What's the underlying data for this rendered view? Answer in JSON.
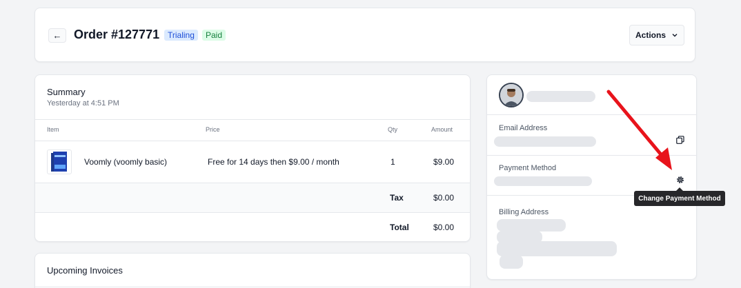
{
  "header": {
    "back_icon": "←",
    "order_title": "Order #127771",
    "badges": {
      "trialing": "Trialing",
      "paid": "Paid"
    },
    "actions_label": "Actions",
    "actions_chevron": "⌄"
  },
  "summary": {
    "title": "Summary",
    "subtitle": "Yesterday at 4:51 PM",
    "columns": {
      "item": "Item",
      "price": "Price",
      "qty": "Qty",
      "amount": "Amount"
    },
    "line_item": {
      "name": "Voomly (voomly basic)",
      "price": "Free for 14 days then $9.00 / month",
      "qty": "1",
      "amount": "$9.00"
    },
    "tax_label": "Tax",
    "tax_value": "$0.00",
    "total_label": "Total",
    "total_value": "$0.00"
  },
  "upcoming": {
    "title": "Upcoming Invoices"
  },
  "customer": {
    "email_label": "Email Address",
    "payment_label": "Payment Method",
    "billing_label": "Billing Address"
  },
  "tooltip": {
    "text": "Change Payment Method"
  },
  "colors": {
    "annotation_arrow": "#e8131b",
    "trialing_bg": "#dbeafe",
    "paid_bg": "#dcfce7"
  }
}
